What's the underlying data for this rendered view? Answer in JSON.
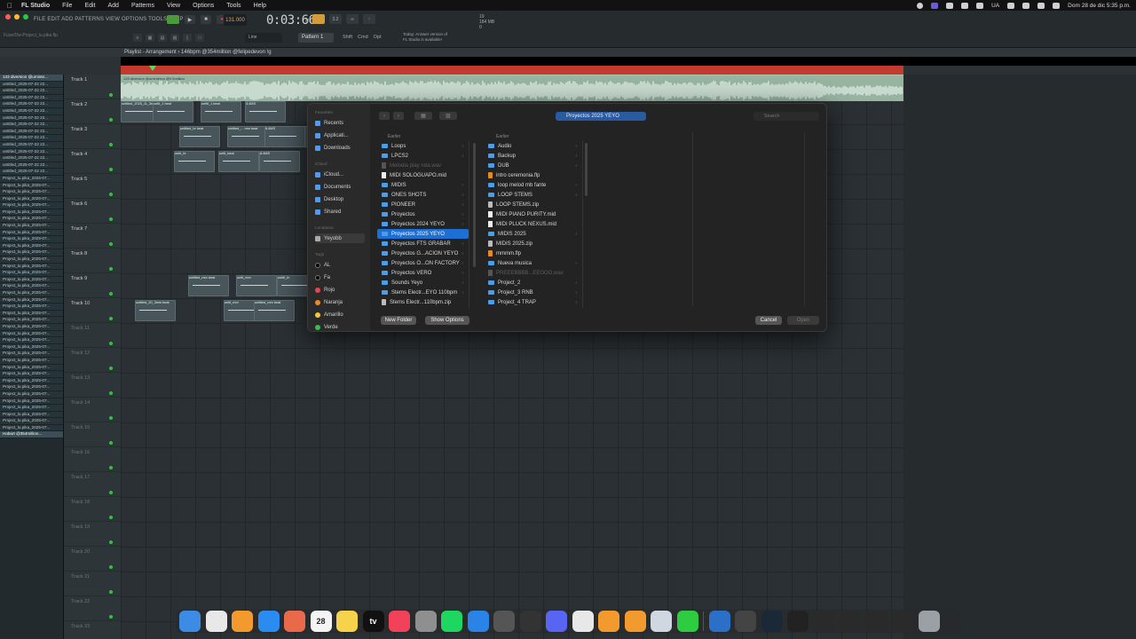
{
  "menubar": {
    "app": "FL Studio",
    "items": [
      "File",
      "Edit",
      "Add",
      "Patterns",
      "View",
      "Options",
      "Tools",
      "Help"
    ],
    "right": [
      "UA",
      "Dom 28 de dic  5:35 p.m."
    ]
  },
  "toolbar": {
    "fl_menu": "FILE EDIT ADD PATTERNS VIEW OPTIONS TOOLS HELP",
    "hint": "Fuse/Dw-Project_lu.pika.flp",
    "bpm": "131.000",
    "time": "0:03:66",
    "time_unit": "M:S:CS",
    "mode_label": "3.2",
    "cpu": [
      "19",
      "184 MB",
      "0"
    ],
    "line_label": "Line",
    "pattern_label": "Pattern 1",
    "modes2": [
      "Shift",
      "Cmd",
      "Opt"
    ],
    "news": [
      "Today: Answer version of",
      "FL Studio is available!"
    ]
  },
  "playlist": {
    "title": "Playlist - Arrangement › 146bpm @354million @felipedevon !g",
    "audio_clip_label": "133 diversion @uminterna @9.5million",
    "tracks": [
      "Track 1",
      "Track 2",
      "Track 3",
      "Track 4",
      "Track 5",
      "Track 6",
      "Track 7",
      "Track 8",
      "Track 9",
      "Track 10",
      "Track 11",
      "Track 12",
      "Track 13",
      "Track 14",
      "Track 15",
      "Track 16",
      "Track 17",
      "Track 18",
      "Track 19",
      "Track 20",
      "Track 21",
      "Track 22",
      "Track 23"
    ],
    "browser_items": [
      "133 diversion @uminte...",
      "untitled_2025-07-22 22...",
      "untitled_2025-07-22 22...",
      "untitled_2025-07-22 22...",
      "untitled_2025-07-22 22...",
      "untitled_2025-07-22 22...",
      "untitled_2025-07-22 22...",
      "untitled_2025-07-22 22...",
      "untitled_2025-07-22 22...",
      "untitled_2025-07-22 22...",
      "untitled_2025-07-22 22...",
      "untitled_2025-07-22 22...",
      "untitled_2025-07-22 22...",
      "untitled_2025-07-22 22...",
      "untitled_2025-07-22 22...",
      "Project_lu.pika_2025-07...",
      "Project_lu.pika_2025-07...",
      "Project_lu.pika_2025-07...",
      "Project_lu.pika_2025-07...",
      "Project_lu.pika_2025-07...",
      "Project_lu.pika_2025-07...",
      "Project_lu.pika_2025-07...",
      "Project_lu.pika_2025-07...",
      "Project_lu.pika_2025-07...",
      "Project_lu.pika_2025-07...",
      "Project_lu.pika_2025-07...",
      "Project_lu.pika_2025-07...",
      "Project_lu.pika_2025-07...",
      "Project_lu.pika_2025-07...",
      "Project_lu.pika_2025-07...",
      "Project_lu.pika_2025-07...",
      "Project_lu.pika_2025-07...",
      "Project_lu.pika_2025-07...",
      "Project_lu.pika_2025-07...",
      "Project_lu.pika_2025-07...",
      "Project_lu.pika_2025-07...",
      "Project_lu.pika_2025-07...",
      "Project_lu.pika_2025-07...",
      "Project_lu.pika_2025-07...",
      "Project_lu.pika_2025-07...",
      "Project_lu.pika_2025-07...",
      "Project_lu.pika_2025-07...",
      "Project_lu.pika_2025-07...",
      "Project_lu.pika_2025-07...",
      "Project_lu.pika_2025-07...",
      "Project_lu.pika_2025-07...",
      "Project_lu.pika_2025-07...",
      "Project_lu.pika_2025-07...",
      "Project_lu.pika_2025-07...",
      "Project_lu.pika_2025-07...",
      "Project_lu.pika_2025-07...",
      "Project_lu.pika_2025-07...",
      "Project_lu.pika_2025-07...",
      "Hobart @354million..."
    ],
    "clips": [
      {
        "label": "untitled_2025_11_3mm beat",
        "t": 2
      },
      {
        "label": "untit_1 beat",
        "t": 2
      },
      {
        "label": "untitl_1 beat",
        "t": 2
      },
      {
        "label": "3.4MS",
        "t": 2
      },
      {
        "label": "untitled_hr beat",
        "t": 3
      },
      {
        "label": "untitled_... mm beat",
        "t": 3
      },
      {
        "label": "untitl_mm",
        "t": 3
      },
      {
        "label": "8.4MS",
        "t": 3
      },
      {
        "label": "untit_hr",
        "t": 4
      },
      {
        "label": "untit_beat",
        "t": 4
      },
      {
        "label": "8.4MS",
        "t": 4
      },
      {
        "label": "untitled_mm beat",
        "t": 9
      },
      {
        "label": "untit_mm",
        "t": 9
      },
      {
        "label": "untitl_hr",
        "t": 9
      },
      {
        "label": "untitled_20_3mm beat",
        "t": 10
      },
      {
        "label": "untit_mm",
        "t": 10
      },
      {
        "label": "untitled_mm beat",
        "t": 10
      }
    ]
  },
  "dialog": {
    "sidebar": {
      "favorites_header": "Favorites",
      "favorites": [
        "Recents",
        "Applicati...",
        "Downloads"
      ],
      "icloud_header": "iCloud",
      "icloud": [
        "iCloud...",
        "Documents",
        "Desktop",
        "Shared"
      ],
      "locations_header": "Locations",
      "locations": [
        "Yeyobb"
      ],
      "tags_header": "Tags",
      "tags": [
        {
          "name": "AL",
          "color": "#000000"
        },
        {
          "name": "Fa",
          "color": "#000000"
        },
        {
          "name": "Rojo",
          "color": "#e5474b"
        },
        {
          "name": "Naranja",
          "color": "#f08a24"
        },
        {
          "name": "Amarillo",
          "color": "#f4c73c"
        },
        {
          "name": "Verde",
          "color": "#3dbb4a"
        }
      ]
    },
    "location": "Proyectos 2025 YEYO",
    "search_placeholder": "Search",
    "col1_header": "Earlier",
    "col1": [
      {
        "name": "Loops",
        "kind": "folder",
        "dim": false
      },
      {
        "name": "LPCS2",
        "kind": "folder",
        "dim": false
      },
      {
        "name": "Melodia play rota.wav",
        "kind": "file",
        "dim": true
      },
      {
        "name": "MIDI SOLOGUAPO.mid",
        "kind": "file",
        "dim": false
      },
      {
        "name": "MIDIS",
        "kind": "folder",
        "dim": false
      },
      {
        "name": "ONES SHOTS",
        "kind": "folder",
        "dim": false
      },
      {
        "name": "PIONEER",
        "kind": "folder",
        "dim": false
      },
      {
        "name": "Proyectos",
        "kind": "folder",
        "dim": false
      },
      {
        "name": "Proyectos 2024 YEYO",
        "kind": "folder",
        "dim": false
      },
      {
        "name": "Proyectos 2025 YEYO",
        "kind": "folder",
        "dim": false,
        "selected": true
      },
      {
        "name": "Proyectos FTS GRABAR",
        "kind": "folder",
        "dim": false
      },
      {
        "name": "Proyectos G...ACION YEYO",
        "kind": "folder",
        "dim": false
      },
      {
        "name": "Proyectos O...ON FACTORY",
        "kind": "folder",
        "dim": false
      },
      {
        "name": "Proyectos VERO",
        "kind": "folder",
        "dim": false
      },
      {
        "name": "Sounds Yeyo",
        "kind": "folder",
        "dim": false
      },
      {
        "name": "Stems Electr...EYO 110bpm",
        "kind": "folder",
        "dim": false
      },
      {
        "name": "Stems Electr...110bpm.zip",
        "kind": "zip",
        "dim": false
      }
    ],
    "col2_header": "Earlier",
    "col2": [
      {
        "name": "Audio",
        "kind": "folder",
        "dim": false
      },
      {
        "name": "Backup",
        "kind": "folder",
        "dim": false
      },
      {
        "name": "DUB",
        "kind": "folder",
        "dim": false
      },
      {
        "name": "intro ceremonia.flp",
        "kind": "flp",
        "dim": false
      },
      {
        "name": "loop melod mb fante",
        "kind": "folder",
        "dim": false
      },
      {
        "name": "LOOP STEMS",
        "kind": "folder",
        "dim": false
      },
      {
        "name": "LOOP STEMS.zip",
        "kind": "zip",
        "dim": false
      },
      {
        "name": "MIDI PIANO PURITY.mid",
        "kind": "file",
        "dim": false
      },
      {
        "name": "MIDI PLUCK NEXUS.mid",
        "kind": "file",
        "dim": false
      },
      {
        "name": "MIDIS 2025",
        "kind": "folder",
        "dim": false
      },
      {
        "name": "MIDIS 2025.zip",
        "kind": "zip",
        "dim": false
      },
      {
        "name": "mmmm.flp",
        "kind": "flp",
        "dim": false
      },
      {
        "name": "Nueva musica",
        "kind": "folder",
        "dim": false
      },
      {
        "name": "PREEEBBBB...EEOOO.wav",
        "kind": "file",
        "dim": true
      },
      {
        "name": "Project_2",
        "kind": "folder",
        "dim": false
      },
      {
        "name": "Project_3 RNB",
        "kind": "folder",
        "dim": false
      },
      {
        "name": "Project_4 TRAP",
        "kind": "folder",
        "dim": false
      }
    ],
    "new_folder": "New Folder",
    "show_options": "Show Options",
    "cancel": "Cancel",
    "open": "Open"
  },
  "dock": {
    "apps": [
      {
        "name": "finder-icon",
        "color": "#3c8ce6",
        "label": ""
      },
      {
        "name": "chrome-icon",
        "color": "#e8e8e8",
        "label": ""
      },
      {
        "name": "fl-studio-icon",
        "color": "#f29a2e",
        "label": ""
      },
      {
        "name": "app-store-icon",
        "color": "#2a8cf0",
        "label": ""
      },
      {
        "name": "photos-icon",
        "color": "#e96a4a",
        "label": ""
      },
      {
        "name": "calendar-icon",
        "color": "#f4f4f4",
        "label": "28"
      },
      {
        "name": "notes-icon",
        "color": "#f6d34a",
        "label": ""
      },
      {
        "name": "apple-tv-icon",
        "color": "#111111",
        "label": "tv"
      },
      {
        "name": "music-icon",
        "color": "#f2425a",
        "label": ""
      },
      {
        "name": "settings-icon",
        "color": "#8f8f8f",
        "label": ""
      },
      {
        "name": "spotify-icon",
        "color": "#1ed760",
        "label": ""
      },
      {
        "name": "safari-icon",
        "color": "#2a84e8",
        "label": ""
      },
      {
        "name": "logic-icon",
        "color": "#555555",
        "label": ""
      },
      {
        "name": "capcut-icon",
        "color": "#333333",
        "label": ""
      },
      {
        "name": "discord-icon",
        "color": "#5865f2",
        "label": ""
      },
      {
        "name": "pdf-icon",
        "color": "#e8e8e8",
        "label": ""
      },
      {
        "name": "fl-studio-2-icon",
        "color": "#f29a2e",
        "label": ""
      },
      {
        "name": "fl-studio-3-icon",
        "color": "#f29a2e",
        "label": ""
      },
      {
        "name": "preview-icon",
        "color": "#cfd8e0",
        "label": ""
      },
      {
        "name": "facetime-icon",
        "color": "#2ecc40",
        "label": ""
      }
    ],
    "recent": [
      {
        "name": "xcode-icon",
        "color": "#2c6fc8",
        "label": ""
      },
      {
        "name": "recent-app-icon",
        "color": "#444444",
        "label": ""
      },
      {
        "name": "steam-icon",
        "color": "#1b2838",
        "label": ""
      },
      {
        "name": "recent-window-icon",
        "color": "#222222",
        "label": ""
      },
      {
        "name": "recent-window-2-icon",
        "color": "#2a2a2a",
        "label": ""
      },
      {
        "name": "recent-window-3-icon",
        "color": "#2a2a2a",
        "label": ""
      },
      {
        "name": "recent-window-4-icon",
        "color": "#2a2a2a",
        "label": ""
      },
      {
        "name": "recent-window-5-icon",
        "color": "#2a2a2a",
        "label": ""
      },
      {
        "name": "trash-icon",
        "color": "#9aa0a6",
        "label": ""
      }
    ]
  }
}
